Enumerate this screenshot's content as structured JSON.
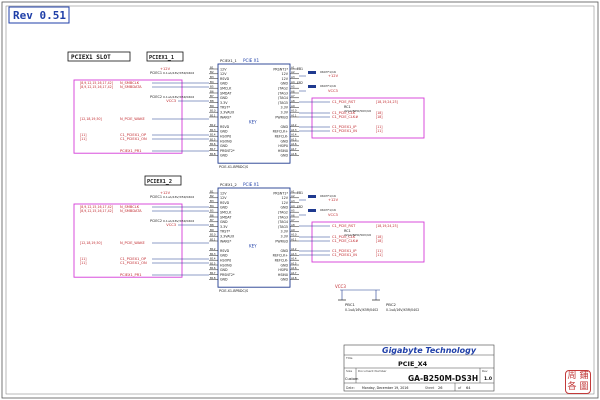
{
  "revision": "Rev 0.51",
  "slots": [
    {
      "title": "PCIEX1 SLOT",
      "ref": "PCIEX1_1",
      "part": "PCIEX1_1",
      "name": "PCIE X1",
      "footprint": "PCIE-X1-BPBDC/S",
      "left_pins": [
        "12V",
        "12V",
        "RSVD",
        "GND",
        "SMCLK",
        "SMDAT",
        "GND",
        "3.3V",
        "TRST*",
        "3.3VAUX",
        "WAKE*",
        "",
        "RSVD",
        "GND",
        "HSOP0",
        "HSON0",
        "GND",
        "PRSNT2*",
        "GND"
      ],
      "left_nums": [
        "B1",
        "B2",
        "B3",
        "B4",
        "B5",
        "B6",
        "B7",
        "B8",
        "B9",
        "B10",
        "B11",
        "",
        "B12",
        "B13",
        "B14",
        "B15",
        "B16",
        "B17",
        "B18"
      ],
      "right_pins": [
        "PRSNT1*",
        "12V",
        "12V",
        "GND",
        "JTAG2",
        "JTAG3",
        "JTAG4",
        "JTAG5",
        "3.3V",
        "3.3V",
        "PWRGD",
        "",
        "GND",
        "REFCLK+",
        "REFCLK-",
        "GND",
        "HSIP0",
        "HSIN0",
        "GND"
      ],
      "right_nums": [
        "A1",
        "A2",
        "A3",
        "A4",
        "A5",
        "A6",
        "A7",
        "A8",
        "A9",
        "A10",
        "A11",
        "",
        "A12",
        "A13",
        "A14",
        "A15",
        "A16",
        "A17",
        "A18"
      ],
      "key_label": "KEY",
      "left_nets": [
        "+12V",
        "N_SMBCLK",
        "N_SMBDATA",
        "VCC3",
        "N_PCIE_WAKE",
        "C1_PCIEX1_OP",
        "C1_PCIEX1_ON",
        "PCIEX1_PR1"
      ],
      "left_refs": [
        "[8,9,12,15,16,17,42]",
        "[8,9,12,15,16,17,42]",
        "",
        "[12,18,19,50]",
        "[11]",
        "[11]"
      ],
      "right_nets": [
        "+12V",
        "VCC3",
        "C1_PCIE_RST",
        "C1_PCIE_CLK",
        "C1_PCIE_CLK#",
        "C1_PCIEX1_IP",
        "C1_PCIEX1_IN"
      ],
      "right_refs": [
        "[18,19,24,23]",
        "[18]",
        "[18]",
        "[11]",
        "[11]"
      ],
      "caps": [
        "PCIEC1",
        "PCIEC2",
        "RC1"
      ],
      "cap_values": [
        "0.1uA/16V/X5R/0402",
        "0.1uA/16V/X5R/0402",
        "22pA/NPO/50V/U0"
      ],
      "fbs": [
        "FB1",
        "FB2"
      ],
      "fb_values": [
        "0603*1/16",
        "0603*1/16"
      ]
    },
    {
      "title": "",
      "ref": "PCIEX1_2",
      "part": "PCIEX1_2",
      "name": "PCIE X1",
      "footprint": "PCIE-X1-BPBDC/S",
      "left_pins": [
        "12V",
        "12V",
        "RSVD",
        "GND",
        "SMCLK",
        "SMDAT",
        "GND",
        "3.3V",
        "TRST*",
        "3.3VAUX",
        "WAKE*",
        "",
        "RSVD",
        "GND",
        "HSOP0",
        "HSON0",
        "GND",
        "PRSNT2*",
        "GND"
      ],
      "left_nums": [
        "B1",
        "B2",
        "B3",
        "B4",
        "B5",
        "B6",
        "B7",
        "B8",
        "B9",
        "B10",
        "B11",
        "",
        "B12",
        "B13",
        "B14",
        "B15",
        "B16",
        "B17",
        "B18"
      ],
      "right_pins": [
        "PRSNT1*",
        "12V",
        "12V",
        "GND",
        "JTAG2",
        "JTAG3",
        "JTAG4",
        "JTAG5",
        "3.3V",
        "3.3V",
        "PWRGD",
        "",
        "GND",
        "REFCLK+",
        "REFCLK-",
        "GND",
        "HSIP0",
        "HSIN0",
        "GND"
      ],
      "right_nums": [
        "A1",
        "A2",
        "A3",
        "A4",
        "A5",
        "A6",
        "A7",
        "A8",
        "A9",
        "A10",
        "A11",
        "",
        "A12",
        "A13",
        "A14",
        "A15",
        "A16",
        "A17",
        "A18"
      ],
      "key_label": "KEY",
      "left_nets": [
        "+12V",
        "N_SMBCLK",
        "N_SMBDATA",
        "VCC3",
        "N_PCIE_WAKE",
        "C1_PCIEX1_OP",
        "C1_PCIEX1_ON",
        "PCIEX1_PR1"
      ],
      "left_refs": [
        "[8,9,12,15,16,17,42]",
        "[8,9,12,15,16,17,42]",
        "",
        "[12,18,19,50]",
        "[11]",
        "[11]"
      ],
      "right_nets": [
        "+12V",
        "VCC3",
        "C1_PCIE_RST",
        "C1_PCIE_CLK",
        "C1_PCIE_CLK#",
        "C1_PCIEX1_IP",
        "C1_PCIEX1_IN"
      ],
      "right_refs": [
        "[18,19,24,23]",
        "[18]",
        "[18]",
        "[11]",
        "[11]"
      ],
      "caps": [
        "PCIEC1",
        "PCIEC2",
        "RC1"
      ],
      "cap_values": [
        "0.1uA/16V/X5R/0402",
        "0.1uA/16V/X5R/0402",
        "22pA/NPO/50V/U0"
      ],
      "fbs": [
        "FB1",
        "FB2"
      ],
      "fb_values": [
        "0603*1/16",
        "0603*1/16"
      ]
    }
  ],
  "bottom": {
    "vcc_label": "VCC3",
    "caps": [
      "PBC1",
      "PBC2"
    ],
    "cap_values": [
      "0.1uA/16V/X5R/0402",
      "0.1uA/16V/X5R/0402"
    ]
  },
  "title_block": {
    "company": "Gigabyte Technology",
    "title_label": "Title",
    "title": "PCIE_X4",
    "size_label": "Size",
    "size": "Custom",
    "doc_label": "Document Number",
    "document": "GA-B250M-DS3H",
    "rev_label": "Rev",
    "rev": "1.0",
    "date_label": "Date:",
    "date": "Monday, December 19, 2016",
    "sheet_label": "Sheet",
    "sheet": "26",
    "of_label": "of",
    "of": "64"
  },
  "stamp_chars": [
    "周",
    "鋪",
    "各",
    "圖"
  ],
  "colors": {
    "wire": "#1f3a8f",
    "pin": "#222222",
    "net": "#c0282d",
    "box": "#d43ad8",
    "blue": "#1f3fa8"
  }
}
